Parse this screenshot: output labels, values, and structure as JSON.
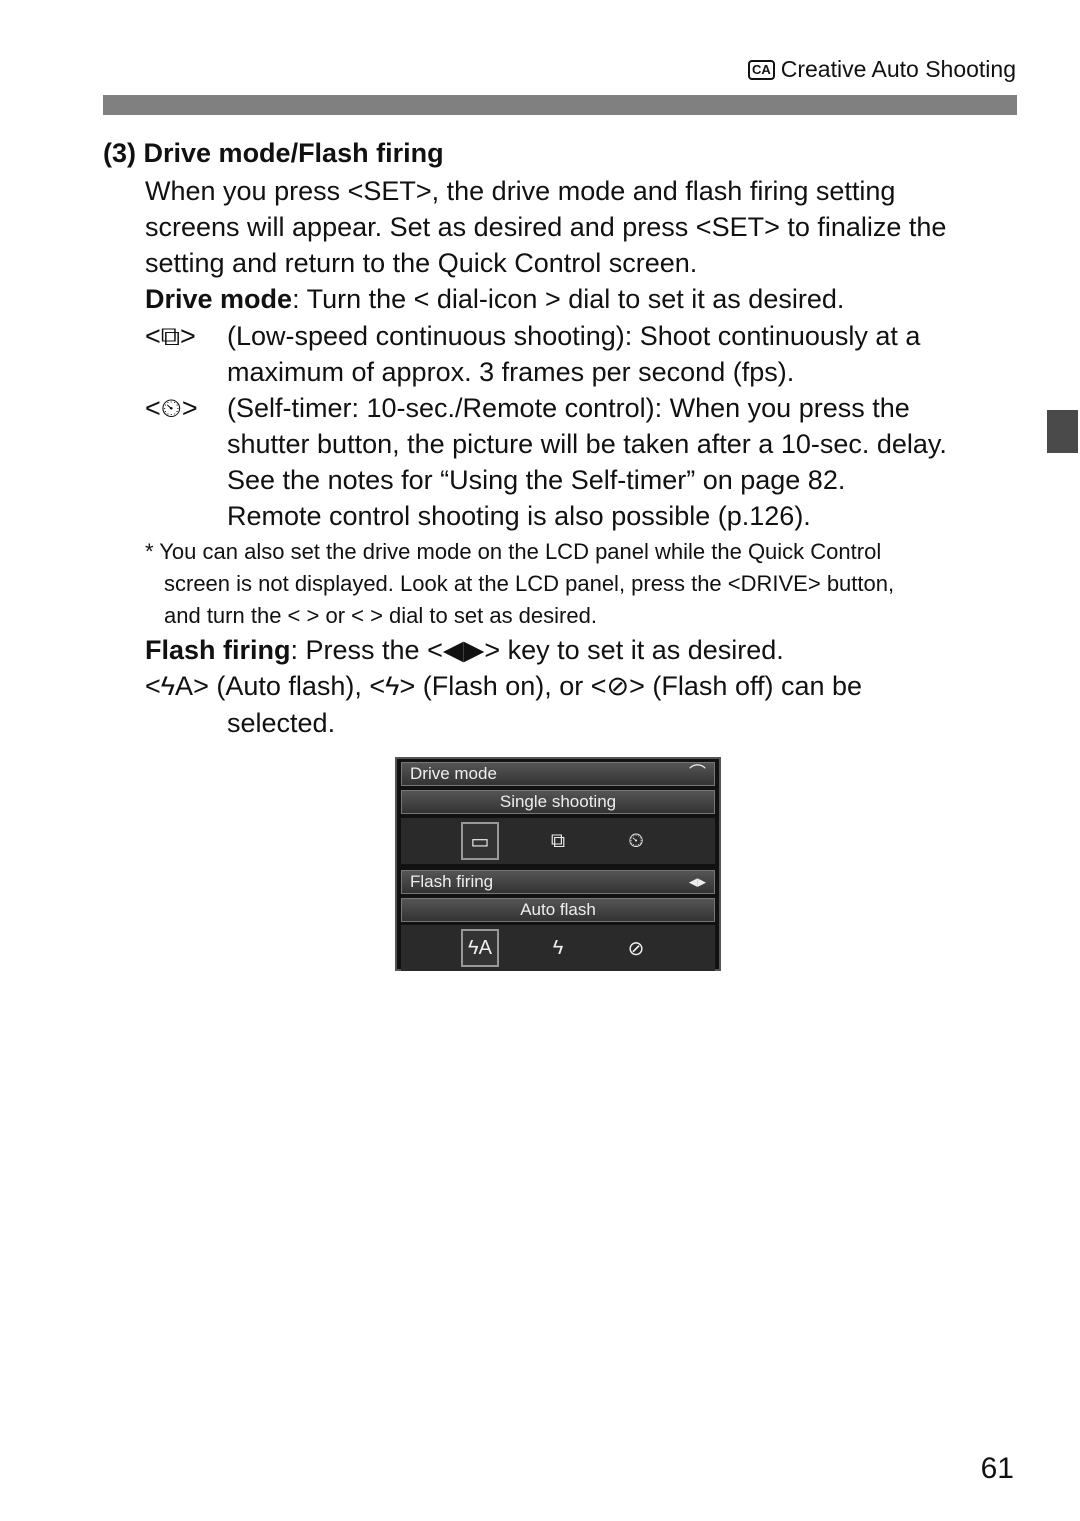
{
  "header": {
    "mode_icon": "CA",
    "section": "Creative Auto Shooting"
  },
  "heading": {
    "number": "(3)",
    "title": "Drive mode/Flash firing"
  },
  "intro": [
    "When you press <SET>, the drive mode and flash firing setting",
    "screens will appear. Set as desired and press <SET> to finalize the",
    "setting and return to the Quick Control screen."
  ],
  "drive_mode": {
    "label": "Drive mode",
    "text": ": Turn the < dial-icon > dial to set it as desired.",
    "items": [
      {
        "icon": "low-speed-continuous-icon",
        "lines": [
          "(Low-speed continuous shooting): Shoot continuously at a",
          "maximum of approx. 3 frames per second (fps)."
        ]
      },
      {
        "icon": "self-timer-remote-icon",
        "lines": [
          "(Self-timer: 10-sec./Remote control): When you press the",
          "shutter button, the picture will be taken after a 10-sec. delay.",
          "See the notes for “Using the Self-timer” on page 82.",
          "Remote control shooting is also possible (p.126)."
        ]
      }
    ]
  },
  "footnote": [
    "* You can also set the drive mode on the LCD panel while the Quick Control",
    "screen is not displayed. Look at the LCD panel, press the <DRIVE> button,",
    "and turn the < > or < > dial to set as desired."
  ],
  "flash_firing": {
    "label": "Flash firing",
    "text": ": Press the <◀▶> key to set it as desired.",
    "line1": "<ϟA> (Auto flash), <ϟ> (Flash on), or <⊘> (Flash off) can be",
    "line2": "selected."
  },
  "lcd": {
    "drive_title": "Drive mode",
    "drive_value": "Single shooting",
    "drive_options": [
      "▭",
      "⧉",
      "⏲"
    ],
    "flash_title": "Flash firing",
    "flash_arrows": "◂▸",
    "flash_value": "Auto flash",
    "flash_options": [
      "ϟA",
      "ϟ",
      "⊘"
    ]
  },
  "page_number": "61"
}
